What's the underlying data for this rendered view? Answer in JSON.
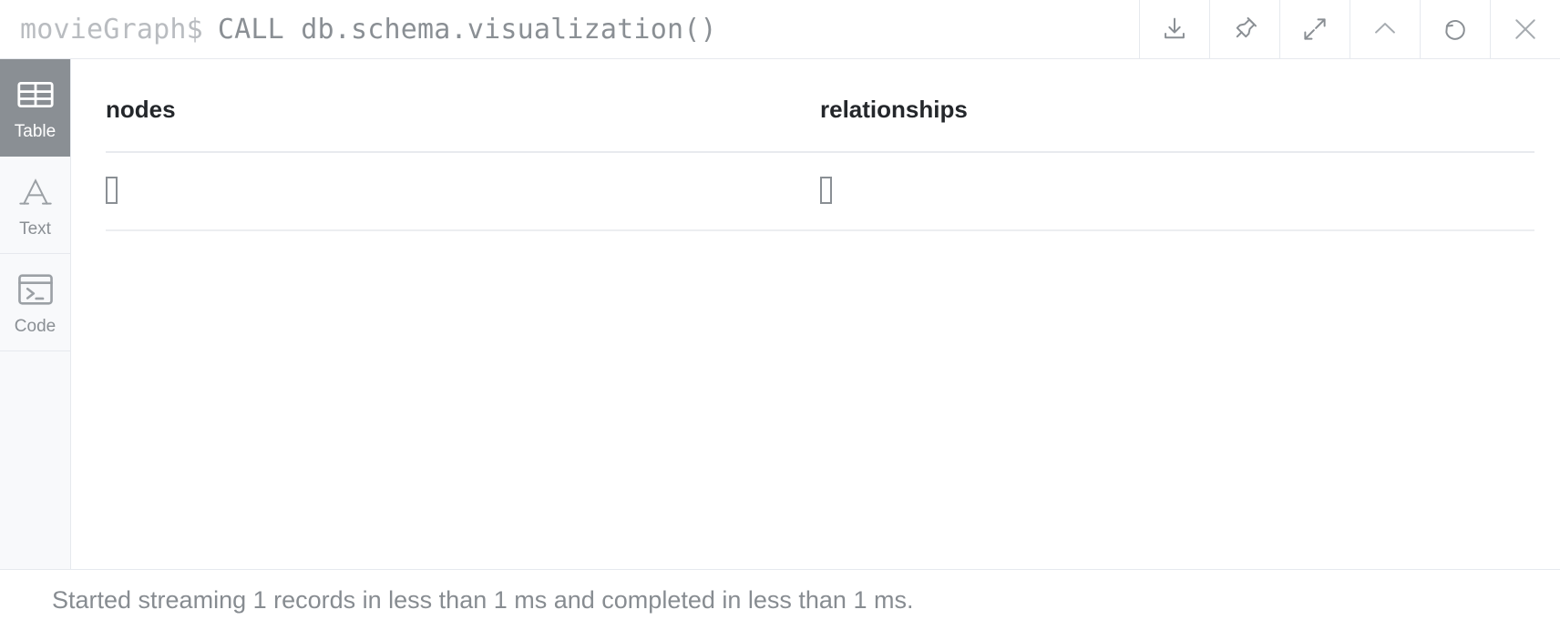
{
  "header": {
    "prompt_prefix": "movieGraph$",
    "query": "CALL db.schema.visualization()",
    "actions": [
      {
        "name": "download-icon",
        "label": "Download"
      },
      {
        "name": "pin-icon",
        "label": "Pin"
      },
      {
        "name": "expand-icon",
        "label": "Expand"
      },
      {
        "name": "chevron-up-icon",
        "label": "Collapse"
      },
      {
        "name": "refresh-icon",
        "label": "Rerun"
      },
      {
        "name": "close-icon",
        "label": "Close"
      }
    ]
  },
  "sidebar": {
    "items": [
      {
        "label": "Table",
        "icon": "table-icon",
        "active": true
      },
      {
        "label": "Text",
        "icon": "text-a-icon",
        "active": false
      },
      {
        "label": "Code",
        "icon": "code-terminal-icon",
        "active": false
      }
    ]
  },
  "table": {
    "columns": [
      "nodes",
      "relationships"
    ],
    "rows": [
      {
        "nodes": "▯",
        "relationships": "▯"
      }
    ]
  },
  "status": {
    "message": "Started streaming 1 records in less than 1 ms and completed in less than 1 ms."
  },
  "colors": {
    "active_sidebar_bg": "#8a8f94",
    "sidebar_bg": "#f8f9fb",
    "border": "#e6e9ee",
    "prompt_gray": "#b9bcc0",
    "query_gray": "#8a8f94",
    "header_text": "#24272b",
    "status_text": "#878c91"
  }
}
